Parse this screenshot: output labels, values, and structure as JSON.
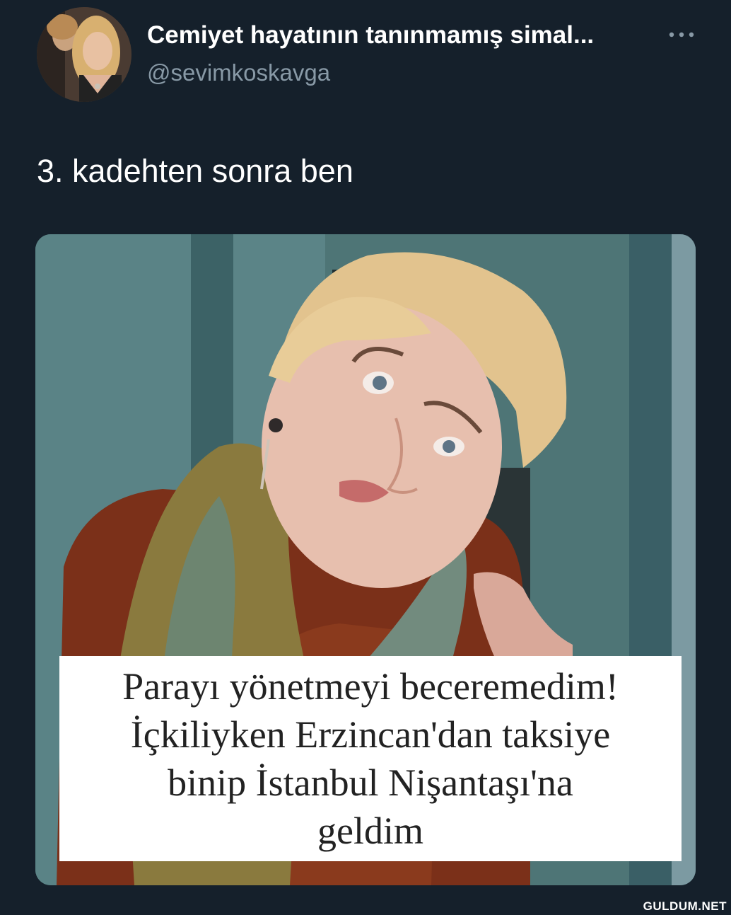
{
  "tweet": {
    "author": {
      "display_name": "Cemiyet hayatının tanınmamış simal...",
      "handle": "@sevimkoskavga",
      "avatar_icon": "profile-photo"
    },
    "more_icon": "ellipsis-icon",
    "text": "3. kadehten sonra ben",
    "media": {
      "caption_lines": [
        "Parayı yönetmeyi beceremedim!",
        "İçkiliyken Erzincan'dan taksiye",
        "binip İstanbul Nişantaşı'na",
        "geldim"
      ]
    }
  },
  "watermark": "GULDUM.NET",
  "colors": {
    "background": "#15202b",
    "primary_text": "#ffffff",
    "secondary_text": "#8899a6"
  }
}
